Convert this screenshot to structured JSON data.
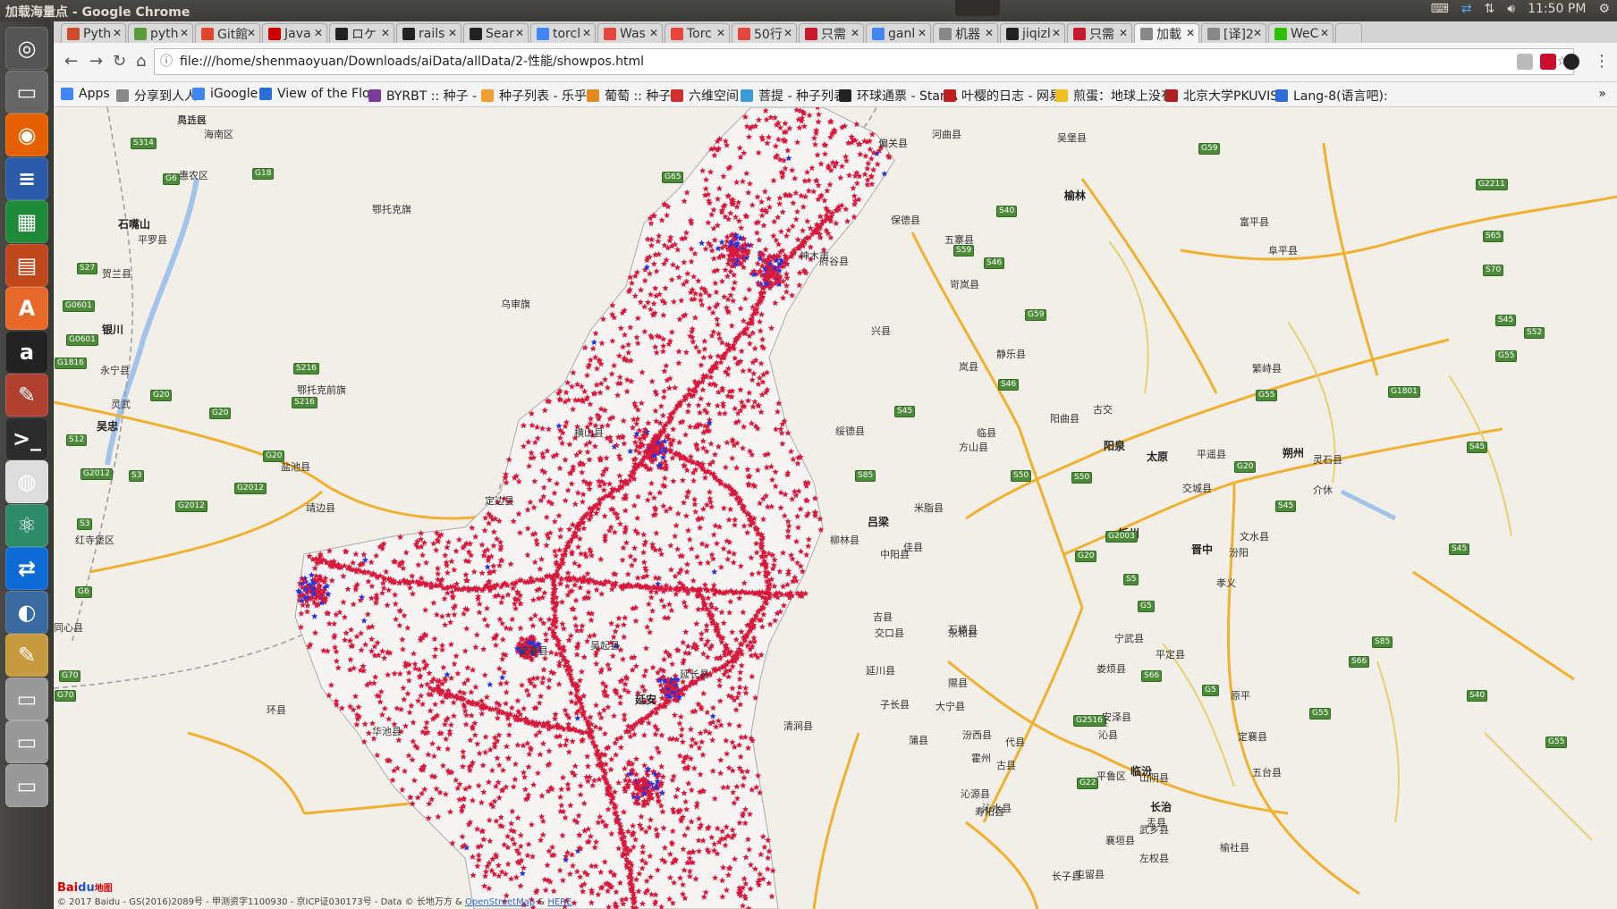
{
  "os": {
    "window_title": "加载海量点 - Google Chrome",
    "clock": "11:50 PM",
    "tray_icons": [
      "keyboard-icon",
      "teamviewer-icon",
      "network-icon",
      "volume-icon",
      "gear-icon"
    ]
  },
  "launcher": {
    "apps": [
      "dash-icon",
      "files-icon",
      "firefox-icon",
      "writer-icon",
      "calc-icon",
      "impress-icon",
      "software-center-icon",
      "amazon-icon",
      "settings-icon",
      "terminal-icon",
      "chrome-icon",
      "atom-icon",
      "teamviewer-icon",
      "wireshark-icon",
      "text-editor-icon",
      "drive-icon",
      "drive-icon",
      "drive-icon"
    ]
  },
  "tabs": [
    {
      "label": "Pyth",
      "color": "#d04a2c"
    },
    {
      "label": "pyth",
      "color": "#5a9b3c"
    },
    {
      "label": "Git館",
      "color": "#e24329"
    },
    {
      "label": "Java",
      "color": "#cc0000"
    },
    {
      "label": "ロケ",
      "color": "#222222"
    },
    {
      "label": "rails",
      "color": "#222222"
    },
    {
      "label": "Sear",
      "color": "#222222"
    },
    {
      "label": "torcl",
      "color": "#4285f4"
    },
    {
      "label": "Was",
      "color": "#e8453c"
    },
    {
      "label": "Torc",
      "color": "#e8453c"
    },
    {
      "label": "50行",
      "color": "#e8453c"
    },
    {
      "label": "只需",
      "color": "#c7192f"
    },
    {
      "label": "ganl",
      "color": "#4285f4"
    },
    {
      "label": "机器",
      "color": "#888888"
    },
    {
      "label": "jiqizl",
      "color": "#222222"
    },
    {
      "label": "只需",
      "color": "#c7192f"
    },
    {
      "label": "加載",
      "color": "#888888",
      "active": true
    },
    {
      "label": "[译]2",
      "color": "#888888"
    },
    {
      "label": "WeC",
      "color": "#2dc100"
    }
  ],
  "toolbar": {
    "url": "file:///home/shenmaoyuan/Downloads/aiData/allData/2-性能/showpos.html"
  },
  "bookmarks": [
    {
      "label": "Apps",
      "color": "#4285f4"
    },
    {
      "label": "分享到人人",
      "color": "#888888"
    },
    {
      "label": "iGoogle",
      "color": "#4285f4"
    },
    {
      "label": "View of the Flow",
      "color": "#2b6fd6"
    },
    {
      "label": "BYRBT :: 种子 - P",
      "color": "#7a3c9b"
    },
    {
      "label": "种子列表 - 乐乎P",
      "color": "#f0a030"
    },
    {
      "label": "葡萄 :: 种子",
      "color": "#e08a20"
    },
    {
      "label": "六维空间",
      "color": "#d03030"
    },
    {
      "label": "菩提 - 种子列表",
      "color": "#3a9bd6"
    },
    {
      "label": "环球通票 - Star A",
      "color": "#222222"
    },
    {
      "label": "叶樱的日志 - 网易",
      "color": "#c02020"
    },
    {
      "label": "煎蛋：地球上没有",
      "color": "#f0c020"
    },
    {
      "label": "北京大学PKUVIS",
      "color": "#b02020"
    },
    {
      "label": "Lang-8(语言吧):",
      "color": "#2b6fd6"
    }
  ],
  "bookmarks_more": "»",
  "map": {
    "place_labels": [
      {
        "text": "乌达区"
      },
      {
        "text": "海南区"
      },
      {
        "text": "惠农区"
      },
      {
        "text": "石嘴山"
      },
      {
        "text": "平罗县"
      },
      {
        "text": "鄂托克旗"
      },
      {
        "text": "贺兰县"
      },
      {
        "text": "银川"
      },
      {
        "text": "永宁县"
      },
      {
        "text": "灵武"
      },
      {
        "text": "吴忠"
      },
      {
        "text": "乌审旗"
      },
      {
        "text": "鄂托克前旗"
      },
      {
        "text": "盐池县"
      },
      {
        "text": "红寺堡区"
      },
      {
        "text": "同心县"
      },
      {
        "text": "环县"
      },
      {
        "text": "华池县"
      },
      {
        "text": "靖边县"
      },
      {
        "text": "横山县"
      },
      {
        "text": "定边县"
      },
      {
        "text": "安塞县"
      },
      {
        "text": "吴起县"
      },
      {
        "text": "延安"
      },
      {
        "text": "延长县"
      },
      {
        "text": "偏关县"
      },
      {
        "text": "河曲县"
      },
      {
        "text": "保德县"
      },
      {
        "text": "神木市"
      },
      {
        "text": "府谷县"
      },
      {
        "text": "兴县"
      },
      {
        "text": "岢岚县"
      },
      {
        "text": "五寨县"
      },
      {
        "text": "岚县"
      },
      {
        "text": "静乐县"
      },
      {
        "text": "临县"
      },
      {
        "text": "方山县"
      },
      {
        "text": "吕梁"
      },
      {
        "text": "柳林县"
      },
      {
        "text": "中阳县"
      },
      {
        "text": "石楼县"
      },
      {
        "text": "交口县"
      },
      {
        "text": "永和县"
      },
      {
        "text": "隰县"
      },
      {
        "text": "大宁县"
      },
      {
        "text": "蒲县"
      },
      {
        "text": "汾西县"
      },
      {
        "text": "霍州"
      },
      {
        "text": "娄烦县"
      },
      {
        "text": "古交"
      },
      {
        "text": "太原"
      },
      {
        "text": "晋中"
      },
      {
        "text": "交城县"
      },
      {
        "text": "文水县"
      },
      {
        "text": "汾阳"
      },
      {
        "text": "孝义"
      },
      {
        "text": "平遥县"
      },
      {
        "text": "介休"
      },
      {
        "text": "灵石县"
      },
      {
        "text": "朔州"
      },
      {
        "text": "宁武县"
      },
      {
        "text": "忻州"
      },
      {
        "text": "阳曲县"
      },
      {
        "text": "阳泉"
      },
      {
        "text": "平定县"
      },
      {
        "text": "和顺县"
      },
      {
        "text": "沁县"
      },
      {
        "text": "长治"
      },
      {
        "text": "临汾"
      },
      {
        "text": "古县"
      },
      {
        "text": "安泽县"
      },
      {
        "text": "沁源县"
      },
      {
        "text": "寿阳县"
      },
      {
        "text": "平鲁区"
      },
      {
        "text": "山阴县"
      },
      {
        "text": "代县"
      },
      {
        "text": "原平"
      },
      {
        "text": "定襄县"
      },
      {
        "text": "五台县"
      },
      {
        "text": "盂县"
      },
      {
        "text": "左权县"
      },
      {
        "text": "榆社县"
      },
      {
        "text": "武乡县"
      },
      {
        "text": "襄垣县"
      },
      {
        "text": "屯留县"
      },
      {
        "text": "长子县"
      },
      {
        "text": "沁水县"
      },
      {
        "text": "吉县"
      },
      {
        "text": "延川县"
      },
      {
        "text": "子长县"
      },
      {
        "text": "清涧县"
      },
      {
        "text": "佳县"
      },
      {
        "text": "米脂县"
      },
      {
        "text": "绥德县"
      },
      {
        "text": "吴堡县"
      },
      {
        "text": "榆林"
      },
      {
        "text": "富平县"
      },
      {
        "text": "阜平县"
      },
      {
        "text": "繁峙县"
      },
      {
        "text": "灵丘县"
      }
    ],
    "road_shields": [
      "S314",
      "G6",
      "G18",
      "G65",
      "S27",
      "G0601",
      "G0601",
      "S216",
      "S216",
      "G20",
      "G20",
      "G20",
      "G2012",
      "G2012",
      "S3",
      "S3",
      "G6",
      "G2012",
      "G70",
      "G70",
      "G1816",
      "S12",
      "S40",
      "S46",
      "S59",
      "G59",
      "G59",
      "S46",
      "S45",
      "S50",
      "S50",
      "S85",
      "G55",
      "G20",
      "G20",
      "G2003",
      "S5",
      "G5",
      "S66",
      "G5",
      "S66",
      "S45",
      "S45",
      "S45",
      "G1801",
      "G55",
      "S45",
      "S52",
      "G2211",
      "S70",
      "S65",
      "G22",
      "G2516",
      "G55",
      "S40",
      "S85",
      "G55"
    ],
    "copyright": "© 2017 Baidu - GS(2016)2089号 - 甲测资字1100930 - 京ICP证030173号 - Data © 长地万方 & ",
    "copyright_link1": "OpenStreetMap",
    "copyright_amp": " & ",
    "copyright_link2": "HERE",
    "logo_main": "Bai",
    "logo_paw": "du",
    "logo_tail": "地图",
    "marker_color": "#d8193c",
    "marker_alt_color": "#2434e0",
    "marker_shape": "star"
  }
}
